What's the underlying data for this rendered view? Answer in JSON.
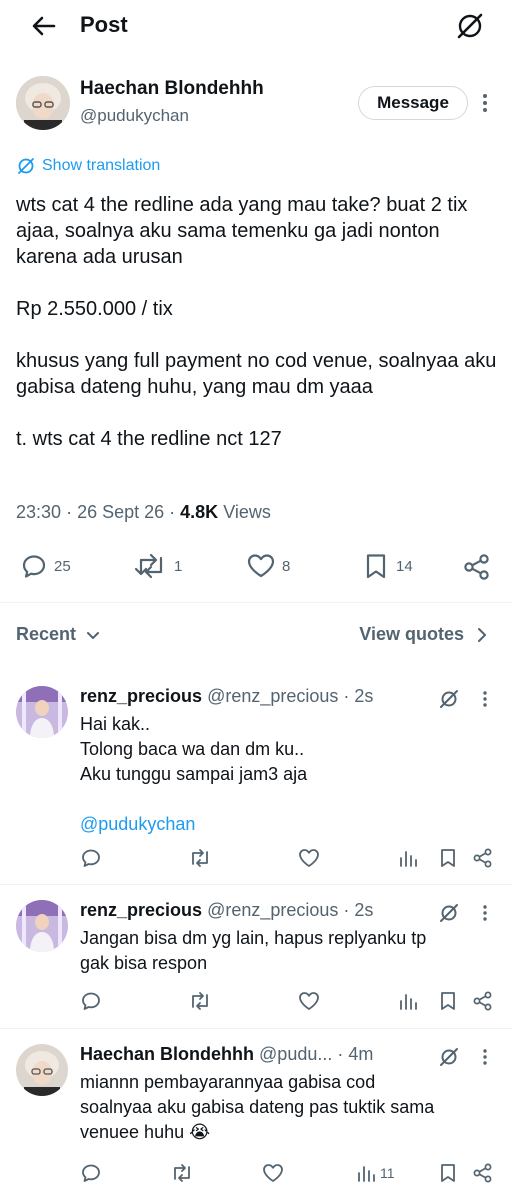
{
  "header": {
    "title": "Post",
    "back_icon": "arrow-left-icon",
    "grok_icon": "grok-icon"
  },
  "author": {
    "name": "Haechan Blondehhh",
    "handle": "@pudukychan",
    "message_label": "Message"
  },
  "translation": {
    "label": "Show translation"
  },
  "post": {
    "paragraphs": [
      "wts cat 4 the redline ada yang mau take? buat 2 tix ajaa, soalnya aku sama temenku ga jadi nonton karena ada urusan",
      "Rp 2.550.000 / tix",
      "khusus yang full payment no cod venue, soalnyaa aku gabisa dateng huhu, yang mau dm yaaa",
      "t. wts cat 4 the redline nct 127"
    ],
    "time": "23:30",
    "date": "26 Sept 26",
    "views_count": "4.8K",
    "views_label": "Views"
  },
  "actions": {
    "replies": "25",
    "reposts": "1",
    "likes": "8",
    "bookmarks": "14"
  },
  "sort": {
    "label": "Recent",
    "quotes_label": "View quotes"
  },
  "replies": [
    {
      "name": "renz_precious",
      "handle": "@renz_precious",
      "time": "2s",
      "lines": [
        "Hai kak..",
        "Tolong baca wa dan dm ku..",
        "Aku tunggu sampai jam3 aja"
      ],
      "mention": "@pudukychan",
      "views": ""
    },
    {
      "name": "renz_precious",
      "handle": "@renz_precious",
      "time": "2s",
      "lines": [
        "Jangan bisa dm yg lain, hapus replyanku tp",
        "gak bisa respon"
      ],
      "views": ""
    },
    {
      "name": "Haechan Blondehhh",
      "handle": "@pudu...",
      "time": "4m",
      "lines": [
        "miannn pembayarannyaa gabisa cod",
        "soalnyaa aku gabisa dateng pas tuktik sama",
        "venuee huhu 😭"
      ],
      "views": "11"
    }
  ],
  "colors": {
    "accent": "#1d9bf0",
    "text": "#0f1419",
    "muted": "#536471",
    "border": "#cfd9de"
  }
}
